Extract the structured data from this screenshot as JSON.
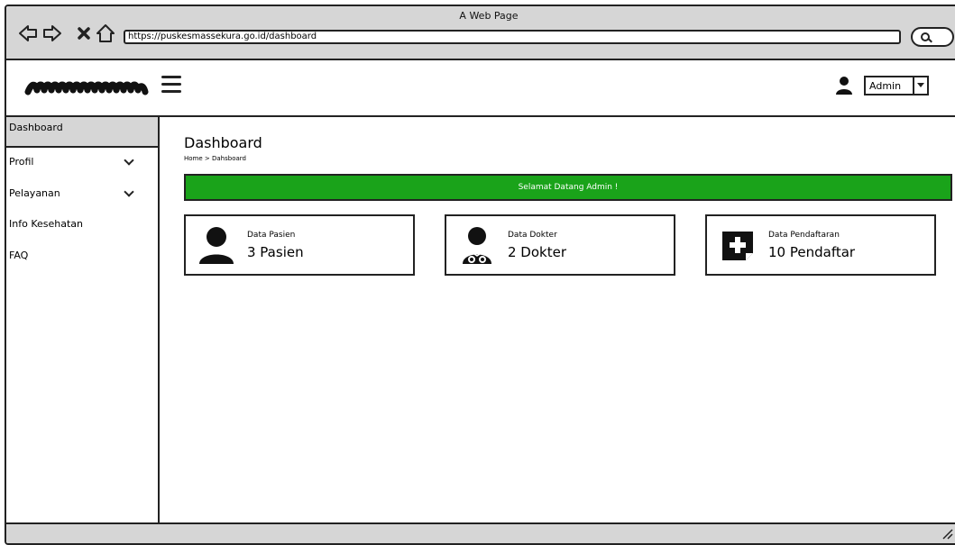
{
  "window": {
    "title": "A Web Page"
  },
  "browser": {
    "url": "https://puskesmassekura.go.id/dashboard",
    "buttons": [
      "back-icon",
      "forward-icon",
      "close-icon",
      "home-icon"
    ]
  },
  "header": {
    "logo_icon": "scribble-logo",
    "menu_icon": "hamburger-icon",
    "user_icon": "user-icon",
    "user_select": {
      "value": "Admin"
    }
  },
  "sidebar": {
    "items": [
      {
        "label": "Dashboard",
        "active": true,
        "has_submenu": false
      },
      {
        "label": "Profil",
        "active": false,
        "has_submenu": true
      },
      {
        "label": "Pelayanan",
        "active": false,
        "has_submenu": true
      },
      {
        "label": "Info Kesehatan",
        "active": false,
        "has_submenu": false
      },
      {
        "label": "FAQ",
        "active": false,
        "has_submenu": false
      }
    ]
  },
  "main": {
    "title": "Dashboard",
    "breadcrumb": "Home > Dahsboard",
    "welcome": "Selamat Datang Admin !",
    "welcome_color": "#1aa31a",
    "cards": [
      {
        "label": "Data Pasien",
        "value": "3 Pasien",
        "icon": "patient-icon"
      },
      {
        "label": "Data Dokter",
        "value": "2 Dokter",
        "icon": "doctor-icon"
      },
      {
        "label": "Data Pendaftaran",
        "value": "10 Pendaftar",
        "icon": "registration-icon"
      }
    ]
  }
}
